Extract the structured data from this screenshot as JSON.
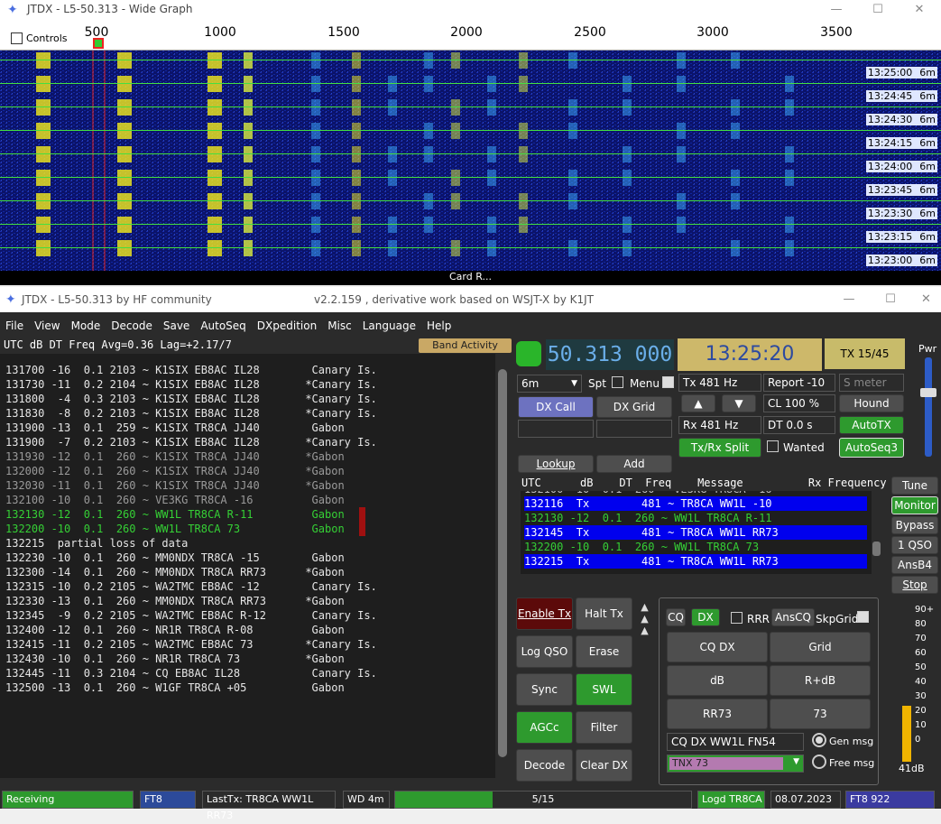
{
  "wide_graph": {
    "title": "JTDX - L5-50.313 - Wide Graph",
    "controls_label": "Controls",
    "scale_ticks": [
      "500",
      "1000",
      "1500",
      "2000",
      "2500",
      "3000",
      "3500"
    ],
    "band_label": "Card R...",
    "rows": [
      {
        "time": "13:25:00",
        "mode": "6m"
      },
      {
        "time": "13:24:45",
        "mode": "6m"
      },
      {
        "time": "13:24:30",
        "mode": "6m"
      },
      {
        "time": "13:24:15",
        "mode": "6m"
      },
      {
        "time": "13:24:00",
        "mode": "6m"
      },
      {
        "time": "13:23:45",
        "mode": "6m"
      },
      {
        "time": "13:23:30",
        "mode": "6m"
      },
      {
        "time": "13:23:15",
        "mode": "6m"
      },
      {
        "time": "13:23:00",
        "mode": "6m"
      }
    ]
  },
  "main_window": {
    "title": "JTDX - L5-50.313   by HF community",
    "subtitle": "v2.2.159 , derivative work based on WSJT-X by K1JT",
    "menu": [
      "File",
      "View",
      "Mode",
      "Decode",
      "Save",
      "AutoSeq",
      "DXpedition",
      "Misc",
      "Language",
      "Help"
    ],
    "band_activity_header": "UTC      dB   DT  Freq    Avg=0.36  Lag=+2.17/7",
    "band_activity_button": "Band Activity",
    "log_lines": [
      {
        "text": "131700 -16  0.1 2103 ~ K1SIX EB8AC IL28        Canary Is.",
        "color": "#e6e6e6"
      },
      {
        "text": "131730 -11  0.2 2104 ~ K1SIX EB8AC IL28       *Canary Is.",
        "color": "#e6e6e6"
      },
      {
        "text": "131800  -4  0.3 2103 ~ K1SIX EB8AC IL28       *Canary Is.",
        "color": "#e6e6e6"
      },
      {
        "text": "131830  -8  0.2 2103 ~ K1SIX EB8AC IL28       *Canary Is.",
        "color": "#e6e6e6"
      },
      {
        "text": "131900 -13  0.1  259 ~ K1SIX TR8CA JJ40        Gabon",
        "color": "#e6e6e6"
      },
      {
        "text": "131900  -7  0.2 2103 ~ K1SIX EB8AC IL28       *Canary Is.",
        "color": "#e6e6e6"
      },
      {
        "text": "131930 -12  0.1  260 ~ K1SIX TR8CA JJ40       *Gabon",
        "color": "#9a9a9a"
      },
      {
        "text": "132000 -12  0.1  260 ~ K1SIX TR8CA JJ40       *Gabon",
        "color": "#9a9a9a"
      },
      {
        "text": "132030 -11  0.1  260 ~ K1SIX TR8CA JJ40       *Gabon",
        "color": "#9a9a9a"
      },
      {
        "text": "132100 -10  0.1  260 ~ VE3KG TR8CA -16         Gabon",
        "color": "#9a9a9a"
      },
      {
        "text": "132130 -12  0.1  260 ~ WW1L TR8CA R-11         Gabon",
        "color": "#35d035"
      },
      {
        "text": "132200 -10  0.1  260 ~ WW1L TR8CA 73           Gabon",
        "color": "#35d035"
      },
      {
        "text": "132215  partial loss of data",
        "color": "#e6e6e6"
      },
      {
        "text": "132230 -10  0.1  260 ~ MM0NDX TR8CA -15        Gabon",
        "color": "#e6e6e6"
      },
      {
        "text": "132300 -14  0.1  260 ~ MM0NDX TR8CA RR73      *Gabon",
        "color": "#e6e6e6"
      },
      {
        "text": "132315 -10  0.2 2105 ~ WA2TMC EB8AC -12        Canary Is.",
        "color": "#e6e6e6"
      },
      {
        "text": "132330 -13  0.1  260 ~ MM0NDX TR8CA RR73      *Gabon",
        "color": "#e6e6e6"
      },
      {
        "text": "132345  -9  0.2 2105 ~ WA2TMC EB8AC R-12       Canary Is.",
        "color": "#e6e6e6"
      },
      {
        "text": "132400 -12  0.1  260 ~ NR1R TR8CA R-08         Gabon",
        "color": "#e6e6e6"
      },
      {
        "text": "132415 -11  0.2 2105 ~ WA2TMC EB8AC 73        *Canary Is.",
        "color": "#e6e6e6"
      },
      {
        "text": "132430 -10  0.1  260 ~ NR1R TR8CA 73          *Gabon",
        "color": "#e6e6e6"
      },
      {
        "text": "132445 -11  0.3 2104 ~ CQ EB8AC IL28           Canary Is.",
        "color": "#e6e6e6"
      },
      {
        "text": "132500 -13  0.1  260 ~ W1GF TR8CA +05          Gabon",
        "color": "#e6e6e6"
      }
    ],
    "frequency": "50.313 000",
    "utc_time": "13:25:20",
    "tx_period": "TX 15/45",
    "pwr_label": "Pwr",
    "band_select": "6m",
    "spt_label": "Spt",
    "menu_label": "Menu",
    "dx_call_btn": "DX Call",
    "dx_grid_btn": "DX Grid",
    "lookup_btn": "Lookup",
    "add_btn": "Add",
    "tx_hz": "Tx  481  Hz",
    "rx_hz": "Rx  481  Hz",
    "report": "Report -10",
    "cl": "CL  100 %",
    "dt": "DT 0.0 s",
    "s_meter_placeholder": "S meter",
    "hound_btn": "Hound",
    "autotx_btn": "AutoTX",
    "autoseq3_btn": "AutoSeq3",
    "txrx_split_btn": "Tx/Rx Split",
    "wanted_label": "Wanted",
    "rx_header": "UTC      dB    DT  Freq    Message          Rx Frequency",
    "rx_lines": [
      {
        "text": "132100 -10  0.1  260 ~ VE3KG TR8CA -16",
        "color": "#bbbbbb",
        "bg": "#1e1e1e"
      },
      {
        "text": "132116  Tx        481 ~ TR8CA WW1L -10",
        "color": "#ffffff",
        "bg": "#0000ee"
      },
      {
        "text": "132130 -12  0.1  260 ~ WW1L TR8CA R-11",
        "color": "#35d035",
        "bg": "#1e1e1e"
      },
      {
        "text": "132145  Tx        481 ~ TR8CA WW1L RR73",
        "color": "#ffffff",
        "bg": "#0000ee"
      },
      {
        "text": "132200 -10  0.1  260 ~ WW1L TR8CA 73",
        "color": "#35d035",
        "bg": "#1e1e1e"
      },
      {
        "text": "132215  Tx        481 ~ TR8CA WW1L RR73",
        "color": "#ffffff",
        "bg": "#0000ee"
      }
    ],
    "side_buttons": [
      "Tune",
      "Monitor",
      "Bypass",
      "1 QSO",
      "AnsB4",
      "Stop"
    ],
    "left_buttons": {
      "enable_tx": "Enable Tx",
      "halt_tx": "Halt Tx",
      "log_qso": "Log QSO",
      "erase": "Erase",
      "sync": "Sync",
      "swl_mode": "SWL mode",
      "agcc": "AGCc",
      "filter": "Filter",
      "decode": "Decode",
      "clear_dx": "Clear DX"
    },
    "tx_panel": {
      "cq": "CQ",
      "dx": "DX",
      "rrr": "RRR",
      "anscq": "AnsCQ",
      "skpgrid": "SkpGrid",
      "cqdx": "CQ DX",
      "grid": "Grid",
      "db": "dB",
      "rdb": "R+dB",
      "rr73": "RR73",
      "s73": "73",
      "gen_msg_value": "CQ DX WW1L FN54",
      "gen_msg": "Gen msg",
      "free_msg_value": "TNX 73",
      "free_msg": "Free msg"
    },
    "meter": {
      "labels": [
        "90+",
        "80",
        "70",
        "60",
        "50",
        "40",
        "30",
        "20",
        "10",
        "0"
      ],
      "level_db": "41dB",
      "level_fraction": 0.41
    },
    "status": {
      "state": "Receiving",
      "mode": "FT8",
      "last_tx": "LastTx: TR8CA WW1L RR73",
      "wd": "WD 4m",
      "progress": "5/15",
      "progress_fraction": 0.33,
      "logd": "Logd TR8CA",
      "date": "08.07.2023",
      "mode_freq": "FT8  922"
    }
  }
}
